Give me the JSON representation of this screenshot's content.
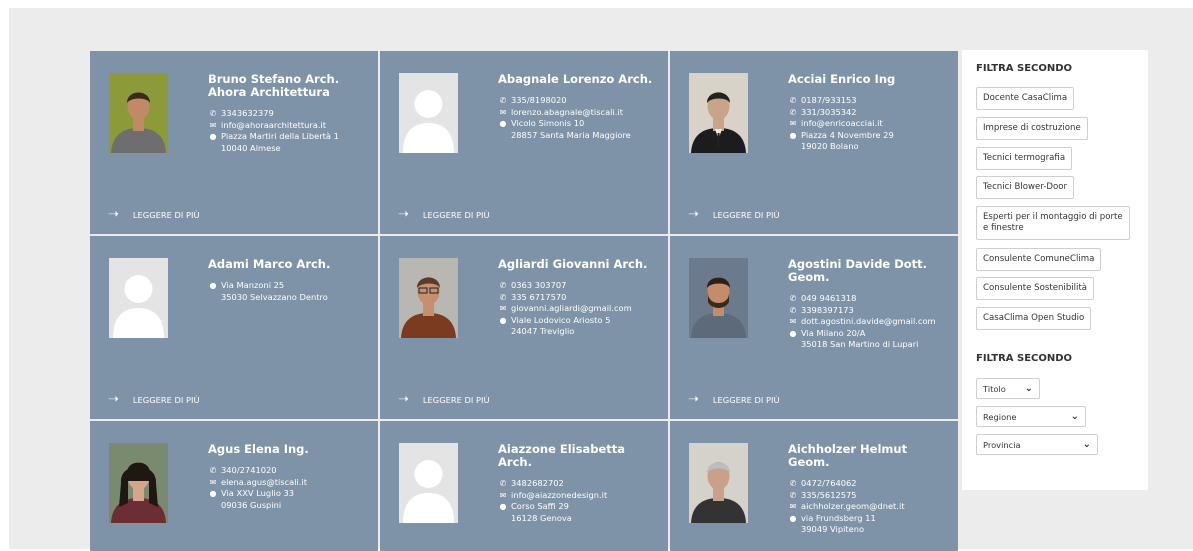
{
  "more_label": "LEGGERE DI PIÙ",
  "cards": [
    {
      "name": "Bruno Stefano Arch. Ahora Architettura",
      "photo": "man-green-bg",
      "lines": [
        {
          "icon": "phone",
          "text": "3343632379"
        },
        {
          "icon": "mail",
          "text": "info@ahoraarchitettura.it"
        },
        {
          "icon": "pin",
          "text": "Piazza Martiri della Libertà 1"
        }
      ],
      "sub": "10040 Almese"
    },
    {
      "name": "Abagnale Lorenzo Arch.",
      "photo": "placeholder",
      "lines": [
        {
          "icon": "phone",
          "text": "335/8198020"
        },
        {
          "icon": "mail",
          "text": "lorenzo.abagnale@tiscali.it"
        },
        {
          "icon": "pin",
          "text": "Vicolo Simonis 10"
        }
      ],
      "sub": "28857 Santa Maria Maggiore"
    },
    {
      "name": "Acciai Enrico Ing",
      "photo": "man-suit",
      "lines": [
        {
          "icon": "phone",
          "text": "0187/933153"
        },
        {
          "icon": "phone",
          "text": "331/3035342"
        },
        {
          "icon": "mail",
          "text": "info@enricoacciai.it"
        },
        {
          "icon": "pin",
          "text": "Piazza 4 Novembre 29"
        }
      ],
      "sub": "19020 Bolano"
    },
    {
      "name": "Adami Marco Arch.",
      "photo": "placeholder",
      "lines": [
        {
          "icon": "pin",
          "text": "Via Manzoni 25"
        }
      ],
      "sub": "35030 Selvazzano Dentro"
    },
    {
      "name": "Agliardi Giovanni Arch.",
      "photo": "man-glasses",
      "lines": [
        {
          "icon": "phone",
          "text": "0363 303707"
        },
        {
          "icon": "phone",
          "text": "335 6717570"
        },
        {
          "icon": "mail",
          "text": "giovanni.agliardi@gmail.com"
        },
        {
          "icon": "pin",
          "text": "Viale Lodovico Ariosto 5"
        }
      ],
      "sub": "24047 Treviglio"
    },
    {
      "name": "Agostini Davide Dott. Geom.",
      "photo": "man-beard",
      "lines": [
        {
          "icon": "phone",
          "text": "049 9461318"
        },
        {
          "icon": "phone",
          "text": "3398397173"
        },
        {
          "icon": "mail",
          "text": "dott.agostini.davide@gmail.com"
        },
        {
          "icon": "pin",
          "text": "Via Milano 20/A"
        }
      ],
      "sub": "35018 San Martino di Lupari"
    },
    {
      "name": "Agus Elena Ing.",
      "photo": "woman",
      "lines": [
        {
          "icon": "phone",
          "text": "340/2741020"
        },
        {
          "icon": "mail",
          "text": "elena.agus@tiscali.it"
        },
        {
          "icon": "pin",
          "text": "Via XXV Luglio 33"
        }
      ],
      "sub": "09036 Guspini"
    },
    {
      "name": "Aiazzone Elisabetta Arch.",
      "photo": "placeholder",
      "lines": [
        {
          "icon": "phone",
          "text": "3482682702"
        },
        {
          "icon": "mail",
          "text": "info@aiazzonedesign.it"
        },
        {
          "icon": "pin",
          "text": "Corso Saffi 29"
        }
      ],
      "sub": "16128 Genova"
    },
    {
      "name": "Aichholzer Helmut Geom.",
      "photo": "man-grey",
      "lines": [
        {
          "icon": "phone",
          "text": "0472/764062"
        },
        {
          "icon": "phone",
          "text": "335/5612575"
        },
        {
          "icon": "mail",
          "text": "aichholzer.geom@dnet.it"
        },
        {
          "icon": "pin",
          "text": "via Frundsberg 11"
        }
      ],
      "sub": "39049 Vipiteno"
    }
  ],
  "sidebar": {
    "title1": "FILTRA SECONDO",
    "tags": [
      "Docente CasaClima",
      "Imprese di costruzione",
      "Tecnici termografia",
      "Tecnici Blower-Door",
      "Esperti per il montaggio di porte e finestre",
      "Consulente ComuneClima",
      "Consulente Sostenibilità",
      "CasaClima Open Studio"
    ],
    "title2": "FILTRA SECONDO",
    "selects": [
      "Titolo",
      "Regione",
      "Provincia"
    ]
  },
  "colors": {
    "card_bg": "#7e93a7",
    "page_bg": "#ececec"
  }
}
